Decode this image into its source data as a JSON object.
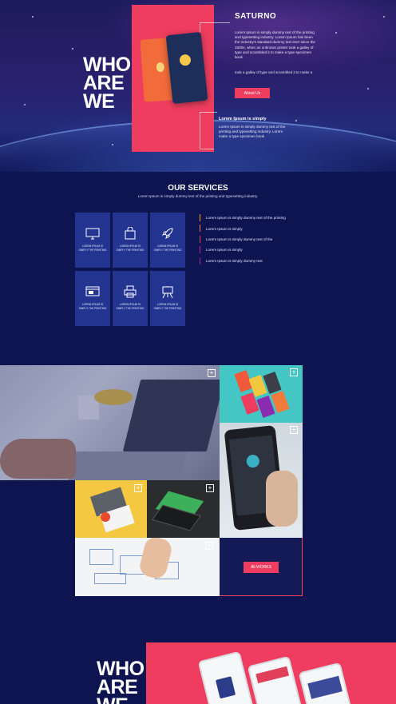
{
  "hero": {
    "brand": "SATURNO",
    "heading_lines": [
      "WHO",
      "ARE",
      "WE"
    ],
    "paragraph1": "Lorem Ipsum is simply dummy text of the printing and typesetting industry. Lorem Ipsum has been the industry's standard dummy text ever since the 1500s, when an unknown printer took a galley of type and scrambled it to make a type specimen book",
    "paragraph2": "took a galley of type and scrambled it to make a",
    "about_button": "About Us",
    "lorem_title": "Lorem Ipsum is simply",
    "lorem_text": "Lorem Ipsum is simply dummy text of the printing and typesetting industry. Lorem make a type specimen book"
  },
  "services": {
    "title": "OUR SERVICES",
    "subtitle": "Lorem Ipsum is simply dummy text of the printing and typesetting industry.",
    "tiles": [
      {
        "icon": "monitor-icon",
        "label": "LOREM IPSUM IS SIMPLY THE PRINTING"
      },
      {
        "icon": "shopping-bag-icon",
        "label": "LOREM IPSUM IS SIMPLY THE PRINTING"
      },
      {
        "icon": "rocket-icon",
        "label": "LOREM IPSUM IS SIMPLY THE PRINTING"
      },
      {
        "icon": "browser-icon",
        "label": "LOREM IPSUM IS SIMPLY THE PRINTING"
      },
      {
        "icon": "printer-icon",
        "label": "LOREM IPSUM IS SIMPLY THE PRINTING"
      },
      {
        "icon": "easel-icon",
        "label": "LOREM IPSUM IS SIMPLY THE PRINTING"
      }
    ],
    "list": [
      {
        "text": "Lorem Ipsum is simply dummy text of the printing",
        "color": "#f5a623"
      },
      {
        "text": "Lorem Ipsum is simply",
        "color": "#f07b3a"
      },
      {
        "text": "Lorem Ipsum is simply dummy text of the",
        "color": "#e0405a"
      },
      {
        "text": "Lorem Ipsum is simply",
        "color": "#c02a8a"
      },
      {
        "text": "Lorem Ipsum is simply dummy text",
        "color": "#9a2bc0"
      }
    ]
  },
  "portfolio": {
    "plus_symbol": "+",
    "all_works_button": "All WORKS"
  },
  "bottom": {
    "heading_lines": [
      "WHO",
      "ARE",
      "WE"
    ]
  },
  "colors": {
    "background": "#0d1450",
    "accent": "#ee3d5e",
    "tile": "#233590"
  }
}
